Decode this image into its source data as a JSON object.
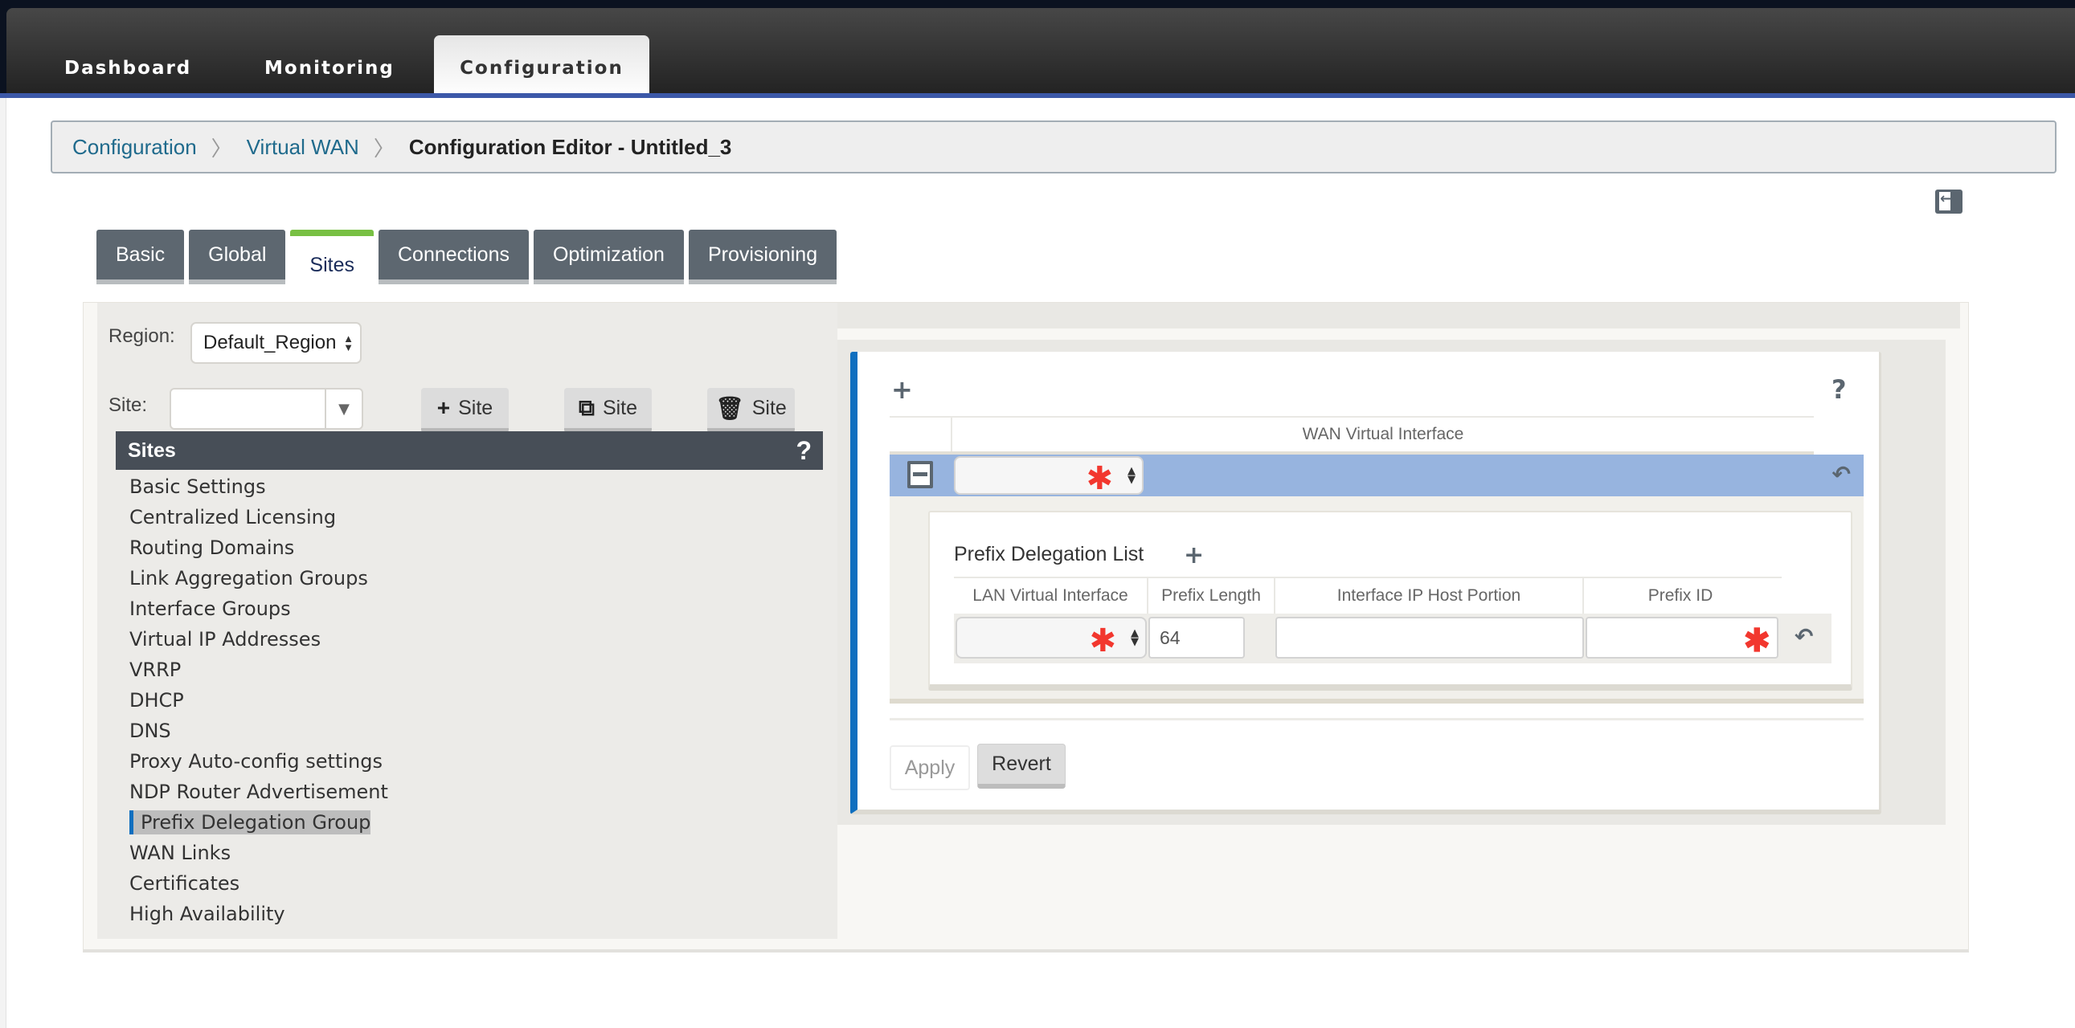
{
  "topnav": {
    "tabs": [
      {
        "label": "Dashboard",
        "active": false
      },
      {
        "label": "Monitoring",
        "active": false
      },
      {
        "label": "Configuration",
        "active": true
      }
    ]
  },
  "breadcrumb": {
    "items": [
      "Configuration",
      "Virtual WAN"
    ],
    "current": "Configuration Editor - Untitled_3",
    "separator": "〉"
  },
  "config_tabs": [
    {
      "label": "Basic",
      "active": false
    },
    {
      "label": "Global",
      "active": false
    },
    {
      "label": "Sites",
      "active": true
    },
    {
      "label": "Connections",
      "active": false
    },
    {
      "label": "Optimization",
      "active": false
    },
    {
      "label": "Provisioning",
      "active": false
    }
  ],
  "left_panel": {
    "region_label": "Region:",
    "region_value": "Default_Region",
    "site_label": "Site:",
    "site_value": "",
    "buttons": {
      "add": "Site",
      "clone": "Site",
      "delete": "Site"
    },
    "sites_header": "Sites",
    "help": "?",
    "site_items": [
      "Basic Settings",
      "Centralized Licensing",
      "Routing Domains",
      "Link Aggregation Groups",
      "Interface Groups",
      "Virtual IP Addresses",
      "VRRP",
      "DHCP",
      "DNS",
      "Proxy Auto-config settings",
      "NDP Router Advertisement",
      "Prefix Delegation Group",
      "WAN Links",
      "Certificates",
      "High Availability"
    ],
    "active_item": "Prefix Delegation Group"
  },
  "editor": {
    "help": "?",
    "wan_header": "WAN Virtual Interface",
    "wan_value": "",
    "prefix_list_title": "Prefix Delegation List",
    "prefix_columns": [
      "LAN Virtual Interface",
      "Prefix Length",
      "Interface IP Host Portion",
      "Prefix ID"
    ],
    "prefix_row": {
      "lan_virtual_interface": "",
      "prefix_length": "64",
      "interface_ip_host_portion": "",
      "prefix_id": ""
    },
    "apply_label": "Apply",
    "revert_label": "Revert",
    "required_mark": "✱"
  },
  "colors": {
    "accent_blue": "#0f6fbf",
    "active_tab_green": "#78c043",
    "selected_row": "#97b4df",
    "required_red": "#f2372e",
    "nav_accent": "#3c58a8"
  }
}
